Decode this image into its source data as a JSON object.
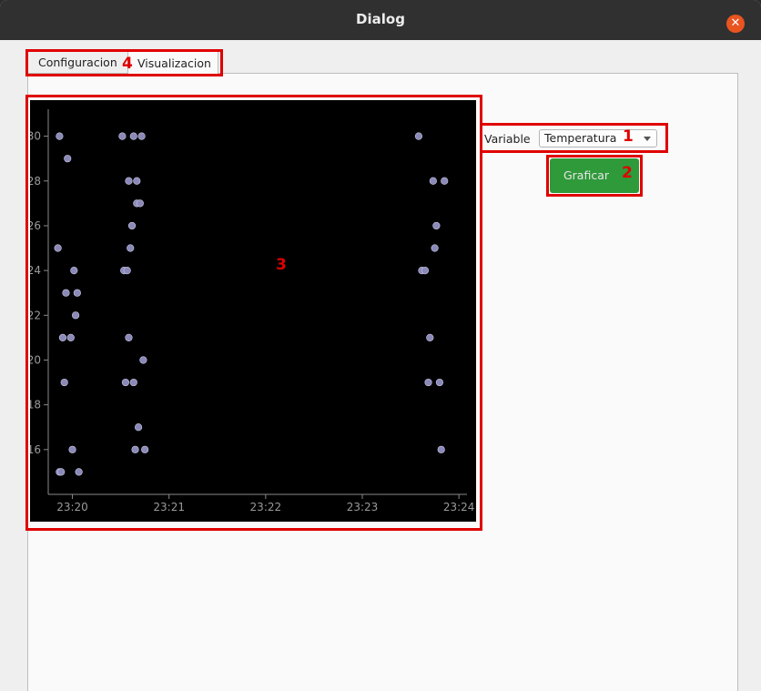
{
  "window": {
    "title": "Dialog"
  },
  "tabs": [
    {
      "label": "Configuracion",
      "active": false
    },
    {
      "label": "Visualizacion",
      "active": true
    }
  ],
  "controls": {
    "variable_label": "Variable",
    "variable_select": {
      "value": "Temperatura"
    },
    "plot_button_label": "Graficar"
  },
  "annotations": {
    "n1": "1",
    "n2": "2",
    "n3": "3",
    "n4": "4"
  },
  "colors": {
    "accent": "#e00000",
    "button": "#2e9a3a",
    "close": "#e95420",
    "point": "#8a89b8"
  },
  "chart_data": {
    "type": "scatter",
    "background": "#000000",
    "grid": false,
    "x_tick_labels": [
      "23:20",
      "23:21",
      "23:22",
      "23:23",
      "23:24"
    ],
    "y_tick_labels": [
      "16",
      "18",
      "20",
      "22",
      "24",
      "26",
      "28",
      "30"
    ],
    "xlim": [
      "23:19:45",
      "23:24:05"
    ],
    "ylim": [
      14,
      31
    ],
    "points": [
      {
        "x": "23:19:52",
        "y": 30
      },
      {
        "x": "23:19:57",
        "y": 29
      },
      {
        "x": "23:19:51",
        "y": 25
      },
      {
        "x": "23:20:01",
        "y": 24
      },
      {
        "x": "23:19:56",
        "y": 23
      },
      {
        "x": "23:20:03",
        "y": 23
      },
      {
        "x": "23:20:02",
        "y": 22
      },
      {
        "x": "23:19:54",
        "y": 21
      },
      {
        "x": "23:19:59",
        "y": 21
      },
      {
        "x": "23:19:55",
        "y": 19
      },
      {
        "x": "23:20:00",
        "y": 16
      },
      {
        "x": "23:19:52",
        "y": 15
      },
      {
        "x": "23:19:53",
        "y": 15
      },
      {
        "x": "23:20:04",
        "y": 15
      },
      {
        "x": "23:20:31",
        "y": 30
      },
      {
        "x": "23:20:38",
        "y": 30
      },
      {
        "x": "23:20:43",
        "y": 30
      },
      {
        "x": "23:20:35",
        "y": 28
      },
      {
        "x": "23:20:40",
        "y": 28
      },
      {
        "x": "23:20:40",
        "y": 27
      },
      {
        "x": "23:20:42",
        "y": 27
      },
      {
        "x": "23:20:37",
        "y": 26
      },
      {
        "x": "23:20:36",
        "y": 25
      },
      {
        "x": "23:20:32",
        "y": 24
      },
      {
        "x": "23:20:34",
        "y": 24
      },
      {
        "x": "23:20:35",
        "y": 21
      },
      {
        "x": "23:20:44",
        "y": 20
      },
      {
        "x": "23:20:33",
        "y": 19
      },
      {
        "x": "23:20:38",
        "y": 19
      },
      {
        "x": "23:20:41",
        "y": 17
      },
      {
        "x": "23:20:39",
        "y": 16
      },
      {
        "x": "23:20:45",
        "y": 16
      },
      {
        "x": "23:23:35",
        "y": 30
      },
      {
        "x": "23:23:44",
        "y": 28
      },
      {
        "x": "23:23:51",
        "y": 28
      },
      {
        "x": "23:23:46",
        "y": 26
      },
      {
        "x": "23:23:45",
        "y": 25
      },
      {
        "x": "23:23:37",
        "y": 24
      },
      {
        "x": "23:23:39",
        "y": 24
      },
      {
        "x": "23:23:42",
        "y": 21
      },
      {
        "x": "23:23:41",
        "y": 19
      },
      {
        "x": "23:23:48",
        "y": 19
      },
      {
        "x": "23:23:49",
        "y": 16
      }
    ]
  }
}
